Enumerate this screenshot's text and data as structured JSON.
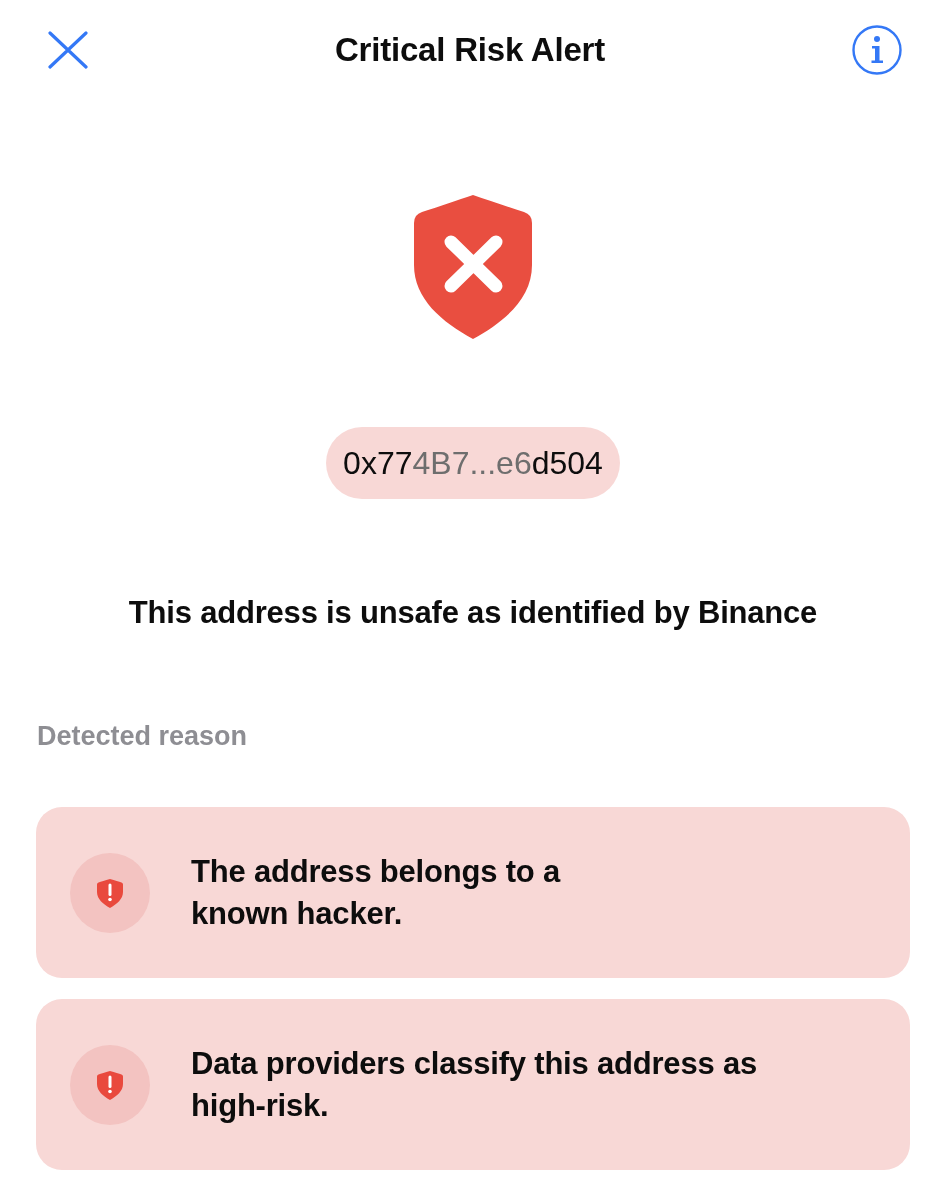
{
  "header": {
    "title": "Critical Risk Alert"
  },
  "alert": {
    "address": {
      "segments": [
        {
          "text": "0x77",
          "dimmed": false
        },
        {
          "text": "4B7...e6",
          "dimmed": true
        },
        {
          "text": "d504",
          "dimmed": false
        }
      ]
    },
    "message": "This address is unsafe as identified by Binance"
  },
  "reasons": {
    "heading": "Detected reason",
    "items": [
      {
        "text": "The address belongs to a\nknown hacker."
      },
      {
        "text": "Data providers classify this address as\nhigh-risk."
      }
    ]
  }
}
